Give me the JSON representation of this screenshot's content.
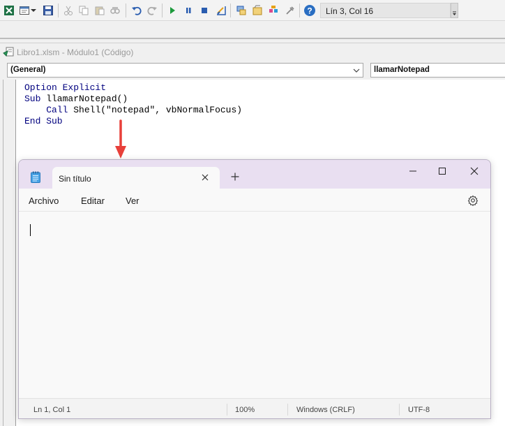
{
  "toolbar": {
    "position_readout": "Lín 3, Col 16"
  },
  "module_window": {
    "title": "Libro1.xlsm - Módulo1 (Código)",
    "object_combo": "(General)",
    "procedure_combo": "llamarNotepad"
  },
  "code": {
    "lines": [
      {
        "kw1": "Option Explicit",
        "rest": ""
      },
      {
        "kw1": "Sub",
        "rest": " llamarNotepad()"
      },
      {
        "indent": "    ",
        "kw1": "Call",
        "rest": " Shell(\"notepad\", vbNormalFocus)"
      },
      {
        "kw1": "End Sub",
        "rest": ""
      }
    ]
  },
  "notepad": {
    "tab_title": "Sin título",
    "menu": {
      "file": "Archivo",
      "edit": "Editar",
      "view": "Ver"
    },
    "status": {
      "position": "Ln 1, Col 1",
      "zoom": "100%",
      "line_ending": "Windows (CRLF)",
      "encoding": "UTF-8"
    }
  },
  "colors": {
    "vba_keyword": "#00007f",
    "notepad_titlebar": "#e9dff1",
    "annotation_arrow": "#e8403a"
  }
}
